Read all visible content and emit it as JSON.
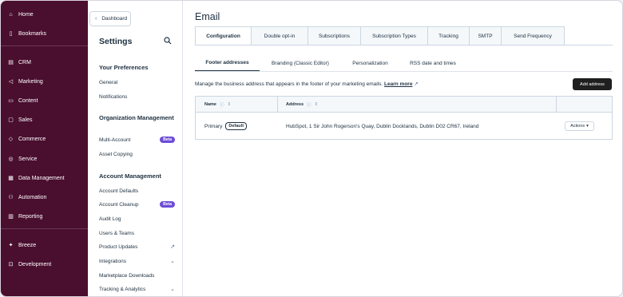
{
  "nav": {
    "items": [
      {
        "label": "Home",
        "icon": "home-icon"
      },
      {
        "label": "Bookmarks",
        "icon": "bookmark-icon"
      },
      {
        "label": "CRM",
        "icon": "crm-icon"
      },
      {
        "label": "Marketing",
        "icon": "marketing-icon"
      },
      {
        "label": "Content",
        "icon": "content-icon"
      },
      {
        "label": "Sales",
        "icon": "sales-icon"
      },
      {
        "label": "Commerce",
        "icon": "commerce-icon"
      },
      {
        "label": "Service",
        "icon": "service-icon"
      },
      {
        "label": "Data Management",
        "icon": "data-management-icon"
      },
      {
        "label": "Automation",
        "icon": "automation-icon"
      },
      {
        "label": "Reporting",
        "icon": "reporting-icon"
      },
      {
        "label": "Breeze",
        "icon": "breeze-icon"
      },
      {
        "label": "Development",
        "icon": "development-icon"
      }
    ],
    "background": "#4a0e2f"
  },
  "sidebar": {
    "back_label": "Dashboard",
    "title": "Settings",
    "sections": [
      {
        "heading": "Your Preferences",
        "items": [
          {
            "label": "General"
          },
          {
            "label": "Notifications"
          }
        ]
      },
      {
        "heading": "Organization Management",
        "items": [
          {
            "label": "Multi-Account",
            "badge": "Beta"
          },
          {
            "label": "Asset Copying"
          }
        ]
      },
      {
        "heading": "Account Management",
        "items": [
          {
            "label": "Account Defaults"
          },
          {
            "label": "Account Cleanup",
            "badge": "Beta"
          },
          {
            "label": "Audit Log"
          },
          {
            "label": "Users & Teams"
          },
          {
            "label": "Product Updates",
            "icon": "external-link-icon"
          },
          {
            "label": "Integrations",
            "icon": "chevron-down-icon"
          },
          {
            "label": "Marketplace Downloads"
          },
          {
            "label": "Tracking & Analytics",
            "icon": "chevron-down-icon"
          }
        ]
      }
    ],
    "beta_color": "#6c4bd8"
  },
  "main": {
    "title": "Email",
    "tabs": [
      "Configuration",
      "Double opt-in",
      "Subscriptions",
      "Subscription Types",
      "Tracking",
      "SMTP",
      "Send Frequency"
    ],
    "active_tab": "Configuration",
    "subtabs": [
      "Footer addresses",
      "Branding (Classic Editor)",
      "Personalization",
      "RSS date and times"
    ],
    "active_subtab": "Footer addresses",
    "description": "Manage the business address that appears in the footer of your marketing emails.",
    "learn_more": "Learn more",
    "add_button": "Add address",
    "table": {
      "columns": [
        "Name",
        "Address"
      ],
      "rows": [
        {
          "name": "Primary",
          "badge": "Default",
          "address": "HubSpot, 1 Sir John Rogerson's Quay, Dublin Docklands, Dublin D02 CR67, Ireland",
          "action": "Actions"
        }
      ]
    }
  }
}
